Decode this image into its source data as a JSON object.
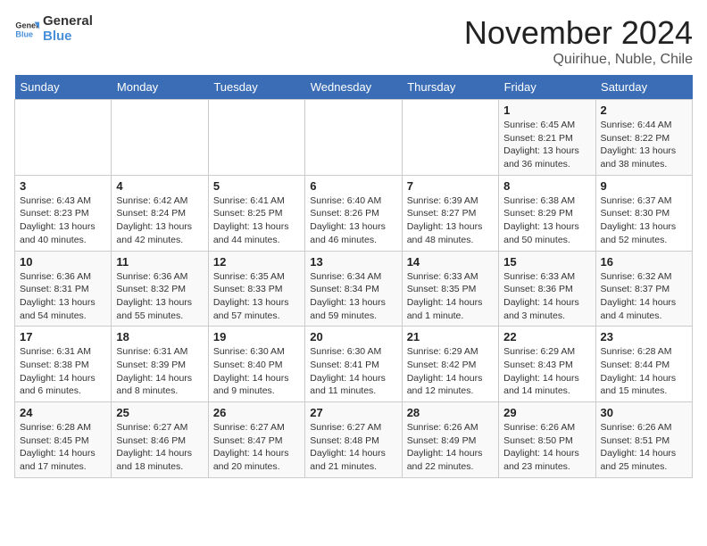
{
  "header": {
    "logo_general": "General",
    "logo_blue": "Blue",
    "month_title": "November 2024",
    "location": "Quirihue, Nuble, Chile"
  },
  "weekdays": [
    "Sunday",
    "Monday",
    "Tuesday",
    "Wednesday",
    "Thursday",
    "Friday",
    "Saturday"
  ],
  "weeks": [
    [
      {
        "day": "",
        "info": ""
      },
      {
        "day": "",
        "info": ""
      },
      {
        "day": "",
        "info": ""
      },
      {
        "day": "",
        "info": ""
      },
      {
        "day": "",
        "info": ""
      },
      {
        "day": "1",
        "info": "Sunrise: 6:45 AM\nSunset: 8:21 PM\nDaylight: 13 hours\nand 36 minutes."
      },
      {
        "day": "2",
        "info": "Sunrise: 6:44 AM\nSunset: 8:22 PM\nDaylight: 13 hours\nand 38 minutes."
      }
    ],
    [
      {
        "day": "3",
        "info": "Sunrise: 6:43 AM\nSunset: 8:23 PM\nDaylight: 13 hours\nand 40 minutes."
      },
      {
        "day": "4",
        "info": "Sunrise: 6:42 AM\nSunset: 8:24 PM\nDaylight: 13 hours\nand 42 minutes."
      },
      {
        "day": "5",
        "info": "Sunrise: 6:41 AM\nSunset: 8:25 PM\nDaylight: 13 hours\nand 44 minutes."
      },
      {
        "day": "6",
        "info": "Sunrise: 6:40 AM\nSunset: 8:26 PM\nDaylight: 13 hours\nand 46 minutes."
      },
      {
        "day": "7",
        "info": "Sunrise: 6:39 AM\nSunset: 8:27 PM\nDaylight: 13 hours\nand 48 minutes."
      },
      {
        "day": "8",
        "info": "Sunrise: 6:38 AM\nSunset: 8:29 PM\nDaylight: 13 hours\nand 50 minutes."
      },
      {
        "day": "9",
        "info": "Sunrise: 6:37 AM\nSunset: 8:30 PM\nDaylight: 13 hours\nand 52 minutes."
      }
    ],
    [
      {
        "day": "10",
        "info": "Sunrise: 6:36 AM\nSunset: 8:31 PM\nDaylight: 13 hours\nand 54 minutes."
      },
      {
        "day": "11",
        "info": "Sunrise: 6:36 AM\nSunset: 8:32 PM\nDaylight: 13 hours\nand 55 minutes."
      },
      {
        "day": "12",
        "info": "Sunrise: 6:35 AM\nSunset: 8:33 PM\nDaylight: 13 hours\nand 57 minutes."
      },
      {
        "day": "13",
        "info": "Sunrise: 6:34 AM\nSunset: 8:34 PM\nDaylight: 13 hours\nand 59 minutes."
      },
      {
        "day": "14",
        "info": "Sunrise: 6:33 AM\nSunset: 8:35 PM\nDaylight: 14 hours\nand 1 minute."
      },
      {
        "day": "15",
        "info": "Sunrise: 6:33 AM\nSunset: 8:36 PM\nDaylight: 14 hours\nand 3 minutes."
      },
      {
        "day": "16",
        "info": "Sunrise: 6:32 AM\nSunset: 8:37 PM\nDaylight: 14 hours\nand 4 minutes."
      }
    ],
    [
      {
        "day": "17",
        "info": "Sunrise: 6:31 AM\nSunset: 8:38 PM\nDaylight: 14 hours\nand 6 minutes."
      },
      {
        "day": "18",
        "info": "Sunrise: 6:31 AM\nSunset: 8:39 PM\nDaylight: 14 hours\nand 8 minutes."
      },
      {
        "day": "19",
        "info": "Sunrise: 6:30 AM\nSunset: 8:40 PM\nDaylight: 14 hours\nand 9 minutes."
      },
      {
        "day": "20",
        "info": "Sunrise: 6:30 AM\nSunset: 8:41 PM\nDaylight: 14 hours\nand 11 minutes."
      },
      {
        "day": "21",
        "info": "Sunrise: 6:29 AM\nSunset: 8:42 PM\nDaylight: 14 hours\nand 12 minutes."
      },
      {
        "day": "22",
        "info": "Sunrise: 6:29 AM\nSunset: 8:43 PM\nDaylight: 14 hours\nand 14 minutes."
      },
      {
        "day": "23",
        "info": "Sunrise: 6:28 AM\nSunset: 8:44 PM\nDaylight: 14 hours\nand 15 minutes."
      }
    ],
    [
      {
        "day": "24",
        "info": "Sunrise: 6:28 AM\nSunset: 8:45 PM\nDaylight: 14 hours\nand 17 minutes."
      },
      {
        "day": "25",
        "info": "Sunrise: 6:27 AM\nSunset: 8:46 PM\nDaylight: 14 hours\nand 18 minutes."
      },
      {
        "day": "26",
        "info": "Sunrise: 6:27 AM\nSunset: 8:47 PM\nDaylight: 14 hours\nand 20 minutes."
      },
      {
        "day": "27",
        "info": "Sunrise: 6:27 AM\nSunset: 8:48 PM\nDaylight: 14 hours\nand 21 minutes."
      },
      {
        "day": "28",
        "info": "Sunrise: 6:26 AM\nSunset: 8:49 PM\nDaylight: 14 hours\nand 22 minutes."
      },
      {
        "day": "29",
        "info": "Sunrise: 6:26 AM\nSunset: 8:50 PM\nDaylight: 14 hours\nand 23 minutes."
      },
      {
        "day": "30",
        "info": "Sunrise: 6:26 AM\nSunset: 8:51 PM\nDaylight: 14 hours\nand 25 minutes."
      }
    ]
  ]
}
